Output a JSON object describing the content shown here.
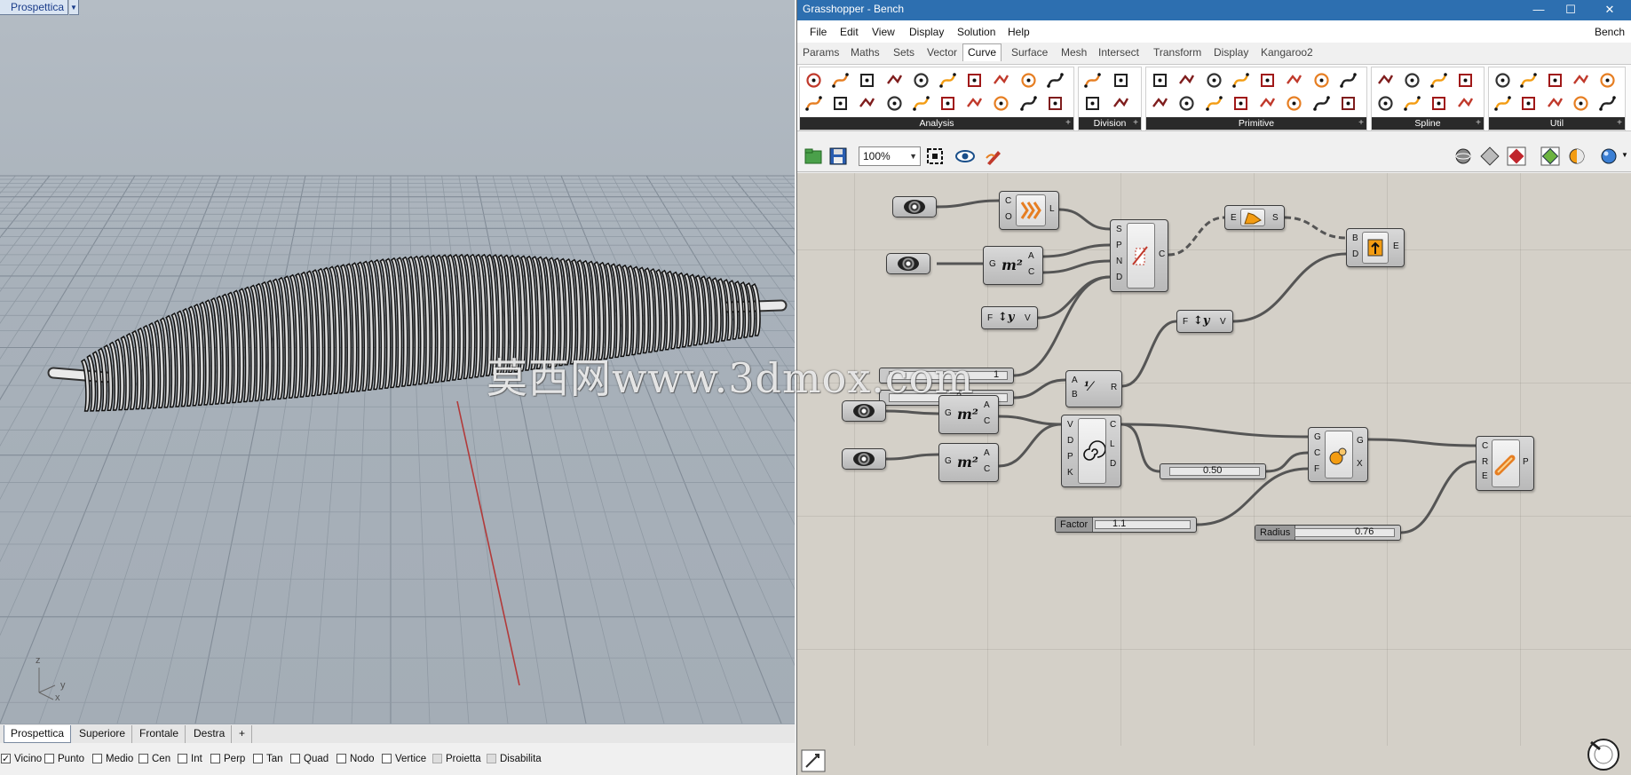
{
  "rhino": {
    "viewport_title": "Prospettica",
    "axis": {
      "z": "z",
      "x": "x",
      "y": "y"
    },
    "view_tabs": [
      "Prospettica",
      "Superiore",
      "Frontale",
      "Destra"
    ],
    "add_tab": "+",
    "osnaps": [
      {
        "label": "Vicino",
        "checked": true
      },
      {
        "label": "Punto",
        "checked": false
      },
      {
        "label": "Medio",
        "checked": false
      },
      {
        "label": "Cen",
        "checked": false
      },
      {
        "label": "Int",
        "checked": false
      },
      {
        "label": "Perp",
        "checked": false
      },
      {
        "label": "Tan",
        "checked": false
      },
      {
        "label": "Quad",
        "checked": false
      },
      {
        "label": "Nodo",
        "checked": false
      },
      {
        "label": "Vertice",
        "checked": false
      },
      {
        "label": "Proietta",
        "checked": false
      },
      {
        "label": "Disabilita",
        "checked": false
      }
    ]
  },
  "grasshopper": {
    "title": "Grasshopper - Bench",
    "window_buttons": {
      "minimize": "—",
      "maximize": "☐",
      "close": "✕"
    },
    "menu": [
      "File",
      "Edit",
      "View",
      "Display",
      "Solution",
      "Help"
    ],
    "document_name": "Bench",
    "tabs": [
      "Params",
      "Maths",
      "Sets",
      "Vector",
      "Curve",
      "Surface",
      "Mesh",
      "Intersect",
      "Transform",
      "Display",
      "Kangaroo2"
    ],
    "active_tab": "Curve",
    "ribbon_panels": [
      "Analysis",
      "Division",
      "Primitive",
      "Spline",
      "Util"
    ],
    "zoom": "100%",
    "canvas": {
      "c1": {
        "in": [
          "C",
          "O"
        ],
        "out": [
          "L"
        ]
      },
      "pipe": {
        "in": [
          "S",
          "P",
          "N",
          "D"
        ],
        "out": [
          "C"
        ]
      },
      "area1": {
        "in": [
          "G"
        ],
        "out": [
          "A",
          "C"
        ]
      },
      "graph1": {
        "in": [
          "F"
        ],
        "out": [
          "V"
        ]
      },
      "explode": {
        "in": [
          "E"
        ],
        "out": [
          "S"
        ]
      },
      "boundary": {
        "in": [
          "B",
          "D"
        ],
        "out": [
          "E"
        ]
      },
      "graph2": {
        "in": [
          "F"
        ],
        "out": [
          "V"
        ]
      },
      "slider_a_value": "1",
      "slider_b_value": "2",
      "div": {
        "in": [
          "A",
          "B"
        ],
        "out": [
          "R"
        ]
      },
      "area2": {
        "in": [
          "G"
        ],
        "out": [
          "A",
          "C"
        ]
      },
      "area3": {
        "in": [
          "G"
        ],
        "out": [
          "A",
          "C"
        ]
      },
      "spiral": {
        "in": [
          "V",
          "D",
          "P",
          "K"
        ],
        "out": [
          "C",
          "L",
          "D"
        ]
      },
      "slider_mid_value": "0.50",
      "scale": {
        "in": [
          "G",
          "C",
          "F"
        ],
        "out": [
          "G",
          "X"
        ]
      },
      "pipe2": {
        "in": [
          "C",
          "R",
          "E"
        ],
        "out": [
          "P"
        ]
      },
      "factor": {
        "label": "Factor",
        "value": "1.1"
      },
      "radius": {
        "label": "Radius",
        "value": "0.76"
      }
    }
  },
  "watermark": "莫西网www.3dmox.com"
}
